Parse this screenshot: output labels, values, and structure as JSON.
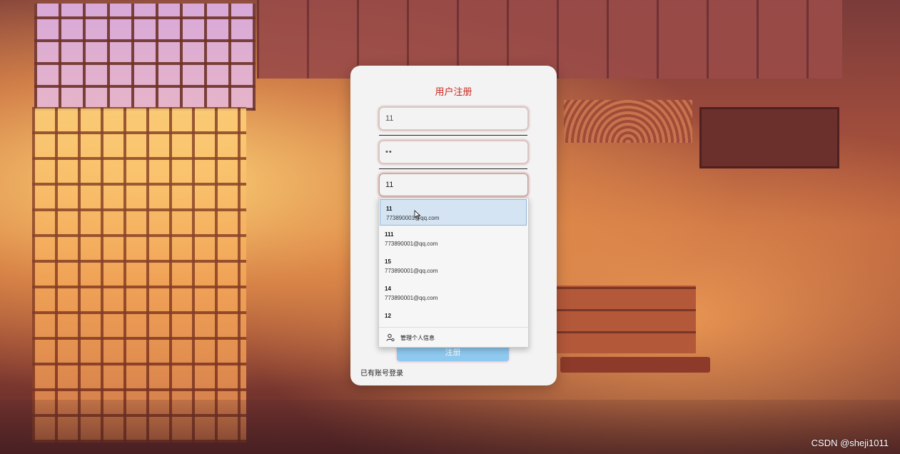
{
  "form": {
    "title": "用户注册",
    "username_value": "11",
    "password_value": "••",
    "email_value": "11",
    "submit_label": "注册",
    "login_link": "已有账号登录"
  },
  "autocomplete": {
    "suggestions": [
      {
        "name": "11",
        "email": "773890001@qq.com",
        "selected": true
      },
      {
        "name": "111",
        "email": "773890001@qq.com",
        "selected": false
      },
      {
        "name": "15",
        "email": "773890001@qq.com",
        "selected": false
      },
      {
        "name": "14",
        "email": "773890001@qq.com",
        "selected": false
      },
      {
        "name": "12",
        "email": "",
        "selected": false
      }
    ],
    "manage_label": "管理个人信息"
  },
  "watermark": "CSDN @sheji1011",
  "colors": {
    "title": "#c8241c",
    "button": "#8ec9ef",
    "selected_suggestion": "#d4e4f3"
  }
}
